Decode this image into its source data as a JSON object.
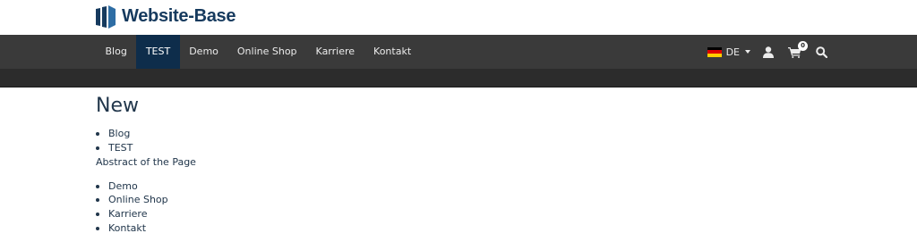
{
  "site": {
    "logo_text": "Website-Base",
    "brand_color": "#163a5e"
  },
  "nav": {
    "items": [
      {
        "label": "Blog",
        "active": false
      },
      {
        "label": "TEST",
        "active": true
      },
      {
        "label": "Demo",
        "active": false
      },
      {
        "label": "Online Shop",
        "active": false
      },
      {
        "label": "Karriere",
        "active": false
      },
      {
        "label": "Kontakt",
        "active": false
      }
    ],
    "language": {
      "code": "DE",
      "icon": "flag-de-icon"
    },
    "user_icon": "user-icon",
    "cart": {
      "icon": "cart-icon",
      "count": "0"
    },
    "search_icon": "search-icon",
    "bar_color": "#3a3a3a",
    "active_color": "#0e2d4b"
  },
  "main": {
    "title": "New",
    "list_top": [
      "Blog",
      "TEST"
    ],
    "abstract": "Abstract of the Page",
    "list_bottom": [
      "Demo",
      "Online Shop",
      "Karriere",
      "Kontakt"
    ]
  }
}
